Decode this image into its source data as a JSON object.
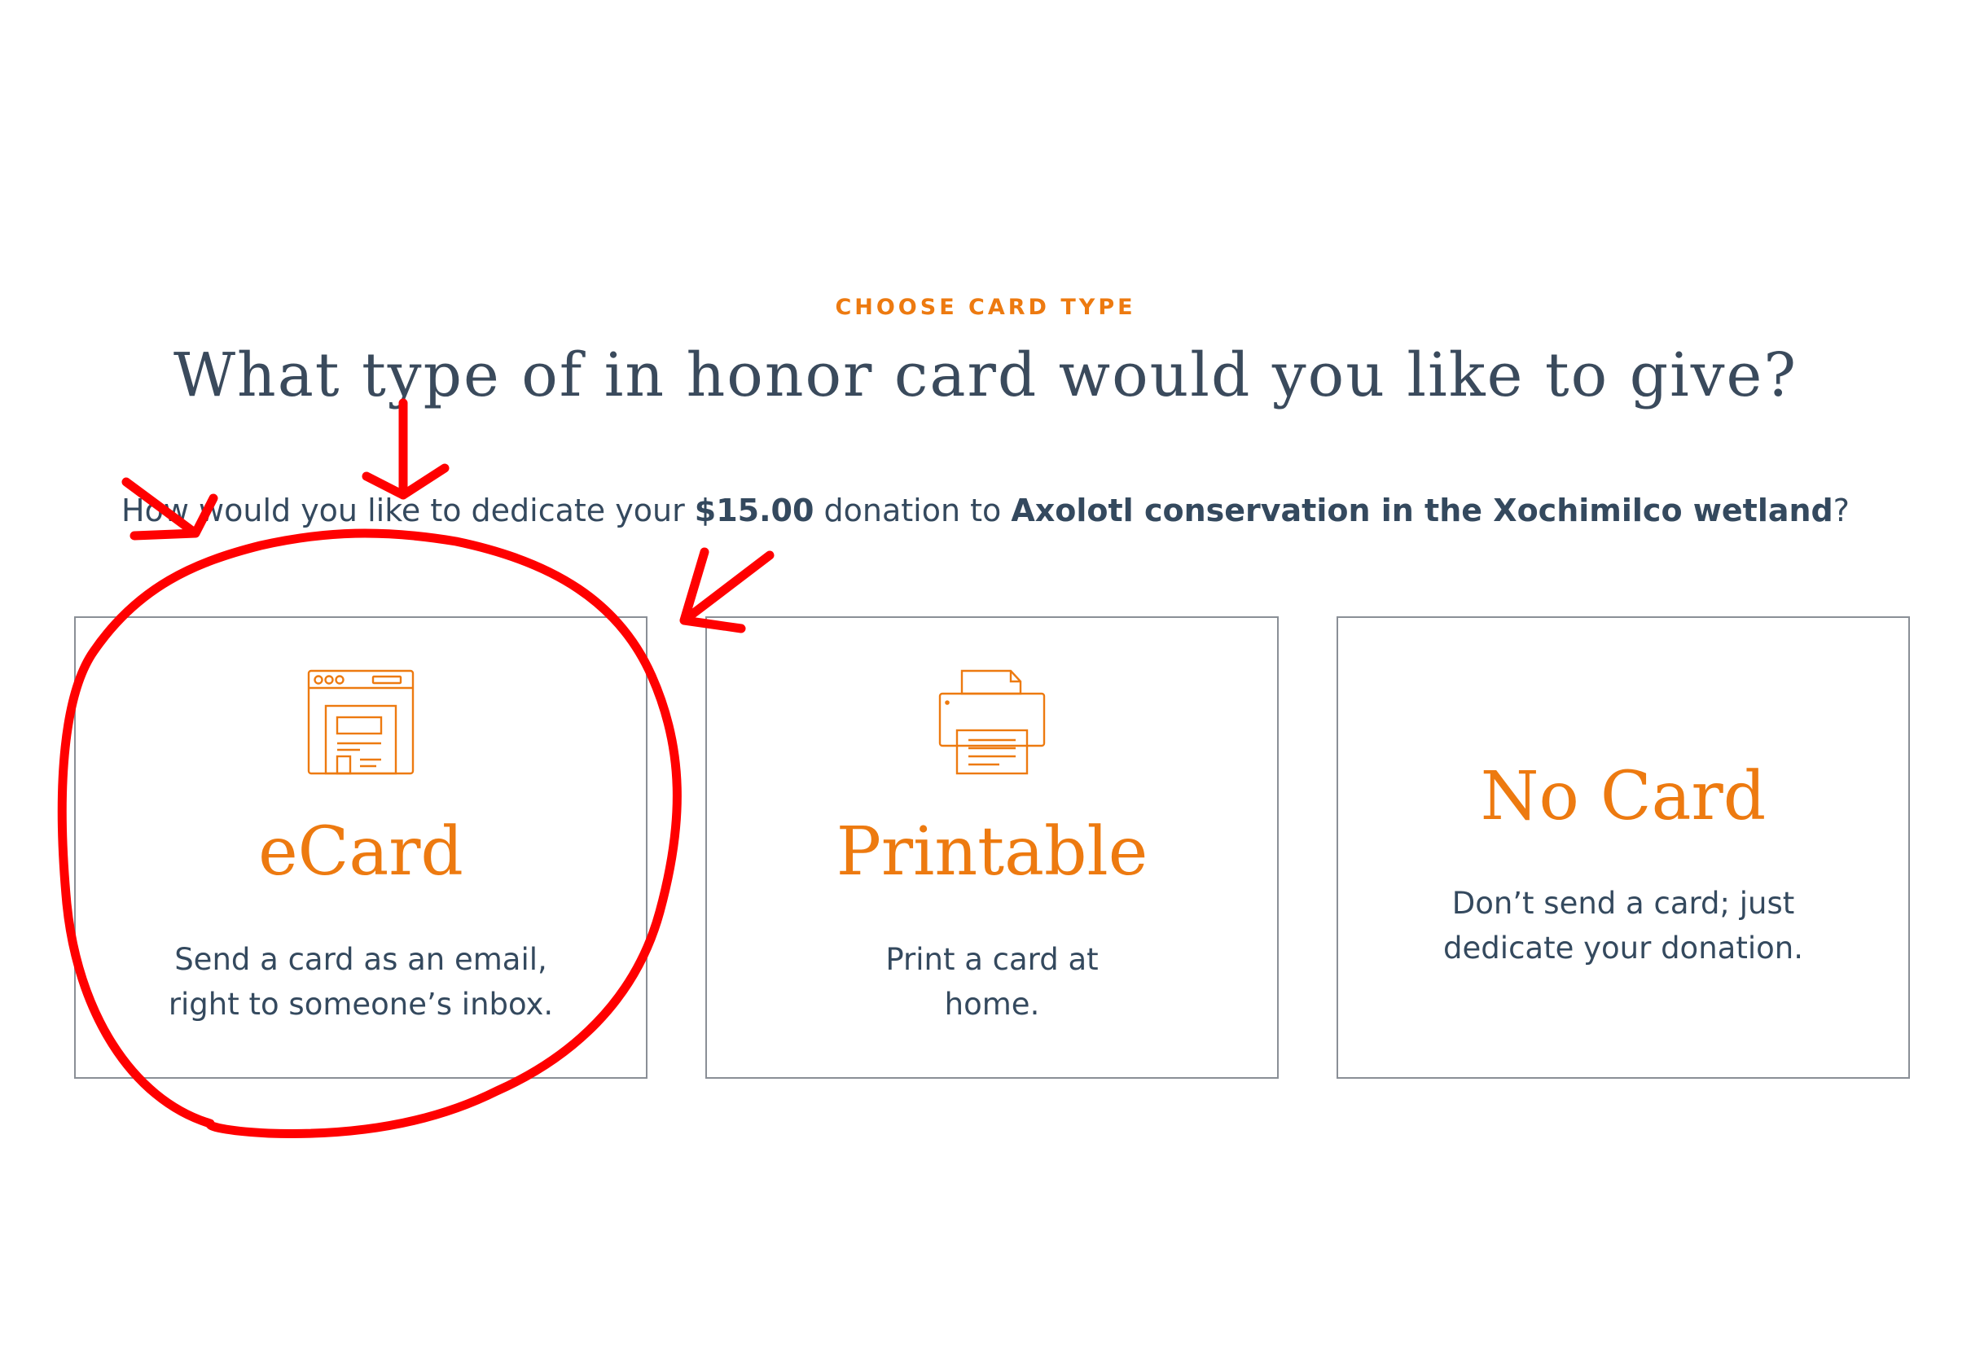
{
  "header": {
    "eyebrow": "CHOOSE CARD TYPE",
    "title": "What type of in honor card would you like to give?"
  },
  "prompt": {
    "prefix": "How would you like to dedicate your ",
    "amount": "$15.00",
    "middle": " donation to ",
    "cause": "Axolotl conservation in the Xochimilco wetland",
    "suffix": "?"
  },
  "cards": [
    {
      "title": "eCard",
      "description": "Send a card as an email, right to someone’s inbox.",
      "icon": "browser-window-icon"
    },
    {
      "title": "Printable",
      "description": "Print a card at home.",
      "icon": "printer-icon"
    },
    {
      "title": "No Card",
      "description": "Don’t send a card; just dedicate your donation.",
      "icon": ""
    }
  ],
  "colors": {
    "accent": "#ed7a10",
    "text": "#34495e",
    "border": "#8a8f96",
    "annotation": "#ff0000"
  }
}
